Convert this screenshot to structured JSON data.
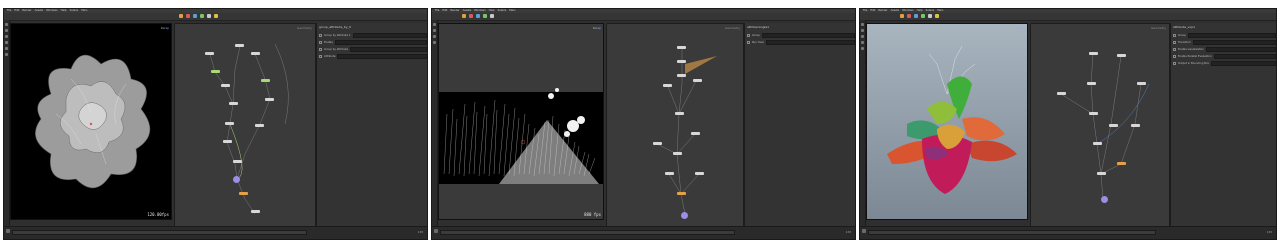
{
  "panels": [
    {
      "menu": [
        "File",
        "Edit",
        "Render",
        "Assets",
        "Windows",
        "Help",
        "Solaris",
        "Main"
      ],
      "viewport_label": "Persp",
      "stat": "120.00fps",
      "network_title": "Geometry",
      "param_title": "group_attribute_by_0",
      "params": [
        {
          "label": "Group by attribute 1"
        },
        {
          "label": "Enable"
        },
        {
          "label": "Group by attribute"
        },
        {
          "label": "Attribute"
        }
      ],
      "frame": "130"
    },
    {
      "menu": [
        "File",
        "Edit",
        "Render",
        "Assets",
        "Windows",
        "Help",
        "Solaris",
        "Main"
      ],
      "viewport_label": "Persp",
      "stat": "880 fps",
      "network_title": "Geometry",
      "param_title": "attribwrangle1",
      "params": [
        {
          "label": "Group"
        },
        {
          "label": "Run Over"
        }
      ],
      "frame": "130"
    },
    {
      "menu": [
        "File",
        "Edit",
        "Render",
        "Assets",
        "Windows",
        "Help",
        "Solaris",
        "Main"
      ],
      "viewport_label": "Persp",
      "stat": "",
      "network_title": "Geometry",
      "param_title": "attribute_vop1",
      "params": [
        {
          "label": "Group"
        },
        {
          "label": "Transform"
        },
        {
          "label": "Enable visualization"
        },
        {
          "label": "Enable Parallel Evaluation"
        },
        {
          "label": "Output in Bounding Box"
        }
      ],
      "frame": "130"
    }
  ],
  "colors": {
    "ui_bg": "#2f2f2f",
    "network_bg": "#3a3a3a",
    "node_green": "#a9d77a",
    "node_orange": "#e3a24a",
    "node_purple": "#9a8ee6",
    "accent_blue": "#4a7fc8"
  }
}
